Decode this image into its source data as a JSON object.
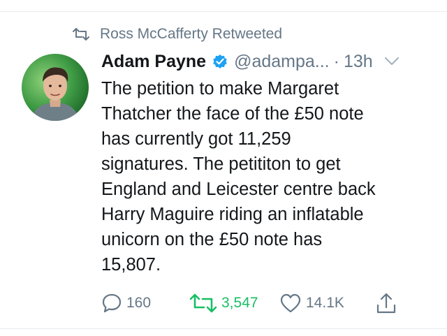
{
  "retweet_context": {
    "text": "Ross McCafferty Retweeted",
    "icon": "retweet-icon"
  },
  "tweet": {
    "author_name": "Adam Payne",
    "verified": true,
    "handle": "@adampa...",
    "separator": "·",
    "timestamp": "13h",
    "text": "The petition to make Margaret\nThatcher the face of the £50 note\nhas currently got 11,259\nsignatures. The petititon to get\nEngland and Leicester centre back\nHarry Maguire riding an inflatable\nunicorn on the £50 note has\n15,807."
  },
  "actions": {
    "reply_count": "160",
    "retweet_count": "3,547",
    "like_count": "14.1K",
    "retweeted": true
  },
  "colors": {
    "text": "#14171a",
    "muted": "#657786",
    "verified": "#1da1f2",
    "retweet_active": "#17bf63",
    "divider": "#e6ecf0"
  }
}
